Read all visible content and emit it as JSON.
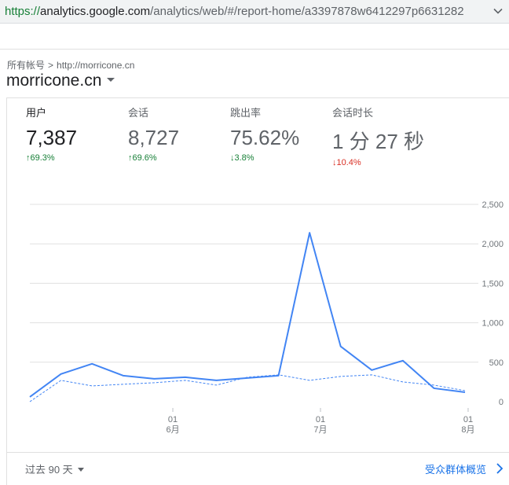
{
  "browser": {
    "url_scheme": "https://",
    "url_host": "analytics.google.com",
    "url_path": "/analytics/web/#/report-home/a3397878w6412297p6631282"
  },
  "header": {
    "breadcrumb_root": "所有帐号",
    "breadcrumb_sep": ">",
    "breadcrumb_account": "http://morricone.cn",
    "property_name": "morricone.cn"
  },
  "metrics": [
    {
      "label": "用户",
      "value": "7,387",
      "delta": "69.3%",
      "direction": "up"
    },
    {
      "label": "会话",
      "value": "8,727",
      "delta": "69.6%",
      "direction": "up"
    },
    {
      "label": "跳出率",
      "value": "75.62%",
      "delta": "3.8%",
      "direction": "down"
    },
    {
      "label": "会话时长",
      "value": "1 分 27 秒",
      "delta": "10.4%",
      "direction": "down"
    }
  ],
  "colors": {
    "primary_line": "#4285f4",
    "compare_line": "#4285f4",
    "grid": "#e0e0e0",
    "positive": "#188038",
    "negative": "#d93025",
    "link": "#1a73e8"
  },
  "chart_data": {
    "type": "line",
    "x": [
      0,
      1,
      2,
      3,
      4,
      5,
      6,
      7,
      8,
      9,
      10,
      11,
      12,
      13,
      14
    ],
    "series": [
      {
        "style": "solid",
        "values": [
          60,
          350,
          480,
          330,
          290,
          310,
          270,
          300,
          330,
          2140,
          700,
          400,
          520,
          170,
          120
        ]
      },
      {
        "style": "dashed",
        "values": [
          0,
          270,
          200,
          220,
          240,
          270,
          210,
          310,
          340,
          270,
          320,
          340,
          250,
          210,
          140
        ]
      }
    ],
    "yticks": [
      "2,500",
      "2,000",
      "1,500",
      "1,000",
      "500",
      "0"
    ],
    "ylim": [
      0,
      2500
    ],
    "xticks": [
      {
        "at": 4.6,
        "day": "01",
        "month": "6月"
      },
      {
        "at": 9.35,
        "day": "01",
        "month": "7月"
      },
      {
        "at": 14.1,
        "day": "01",
        "month": "8月"
      }
    ],
    "grid": true
  },
  "footer": {
    "date_range": "过去 90 天",
    "report_link": "受众群体概览"
  }
}
